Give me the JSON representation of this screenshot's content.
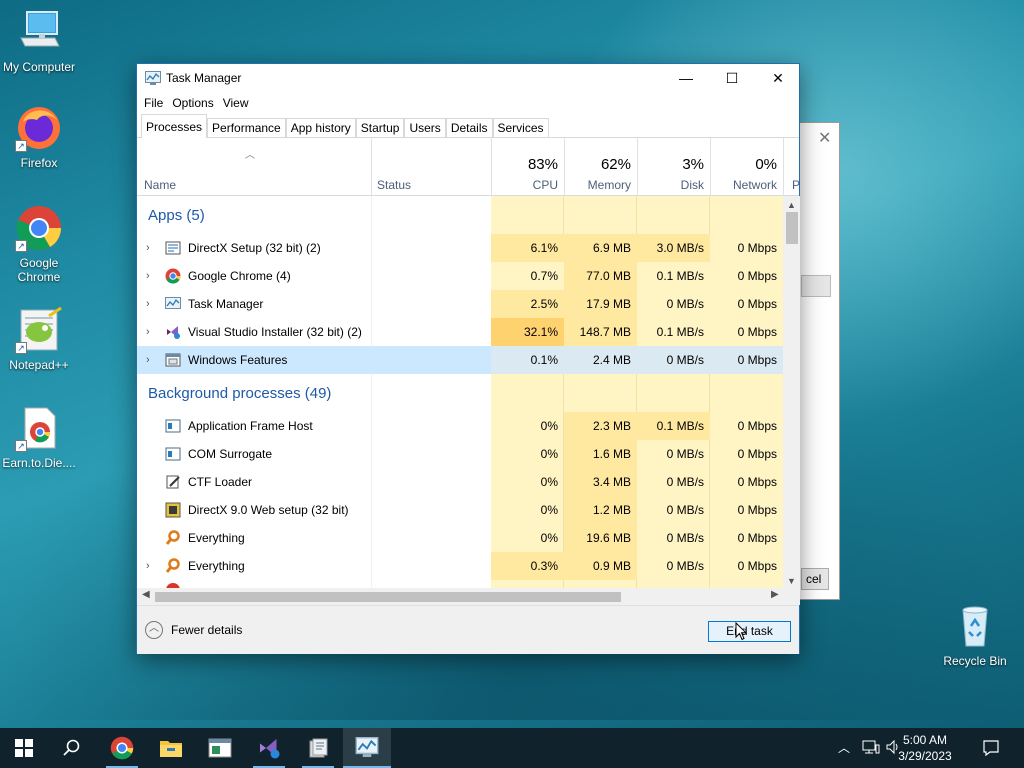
{
  "desktop": {
    "icons": [
      {
        "label": "My Computer"
      },
      {
        "label": "Firefox"
      },
      {
        "label": "Google Chrome"
      },
      {
        "label": "Notepad++"
      },
      {
        "label": "Earn.to.Die...."
      },
      {
        "label": "Recycle Bin"
      }
    ]
  },
  "background_dialog": {
    "button_label": "cel"
  },
  "task_manager": {
    "title": "Task Manager",
    "menu": [
      "File",
      "Options",
      "View"
    ],
    "tabs": [
      "Processes",
      "Performance",
      "App history",
      "Startup",
      "Users",
      "Details",
      "Services"
    ],
    "active_tab": "Processes",
    "columns": {
      "name": "Name",
      "status": "Status",
      "cpu": {
        "pct": "83%",
        "label": "CPU"
      },
      "memory": {
        "pct": "62%",
        "label": "Memory"
      },
      "disk": {
        "pct": "3%",
        "label": "Disk"
      },
      "network": {
        "pct": "0%",
        "label": "Network"
      },
      "power_partial": "P"
    },
    "groups": {
      "apps": "Apps (5)",
      "background": "Background processes (49)"
    },
    "apps": [
      {
        "name": "DirectX Setup (32 bit) (2)",
        "cpu": "6.1%",
        "memory": "6.9 MB",
        "disk": "3.0 MB/s",
        "network": "0 Mbps"
      },
      {
        "name": "Google Chrome (4)",
        "cpu": "0.7%",
        "memory": "77.0 MB",
        "disk": "0.1 MB/s",
        "network": "0 Mbps"
      },
      {
        "name": "Task Manager",
        "cpu": "2.5%",
        "memory": "17.9 MB",
        "disk": "0 MB/s",
        "network": "0 Mbps"
      },
      {
        "name": "Visual Studio Installer (32 bit) (2)",
        "cpu": "32.1%",
        "memory": "148.7 MB",
        "disk": "0.1 MB/s",
        "network": "0 Mbps"
      },
      {
        "name": "Windows Features",
        "cpu": "0.1%",
        "memory": "2.4 MB",
        "disk": "0 MB/s",
        "network": "0 Mbps"
      }
    ],
    "background": [
      {
        "name": "Application Frame Host",
        "cpu": "0%",
        "memory": "2.3 MB",
        "disk": "0.1 MB/s",
        "network": "0 Mbps"
      },
      {
        "name": "COM Surrogate",
        "cpu": "0%",
        "memory": "1.6 MB",
        "disk": "0 MB/s",
        "network": "0 Mbps"
      },
      {
        "name": "CTF Loader",
        "cpu": "0%",
        "memory": "3.4 MB",
        "disk": "0 MB/s",
        "network": "0 Mbps"
      },
      {
        "name": "DirectX 9.0 Web setup (32 bit)",
        "cpu": "0%",
        "memory": "1.2 MB",
        "disk": "0 MB/s",
        "network": "0 Mbps"
      },
      {
        "name": "Everything",
        "cpu": "0%",
        "memory": "19.6 MB",
        "disk": "0 MB/s",
        "network": "0 Mbps"
      },
      {
        "name": "Everything",
        "cpu": "0.3%",
        "memory": "0.9 MB",
        "disk": "0 MB/s",
        "network": "0 Mbps"
      }
    ],
    "footer": {
      "fewer_details": "Fewer details",
      "end_task": "End task"
    }
  },
  "taskbar": {
    "time": "5:00 AM",
    "date": "3/29/2023"
  },
  "colors": {
    "accent": "#0078d7",
    "heat_low": "#fff4c4",
    "heat_mid": "#ffe8a0",
    "heat_high": "#ffd270",
    "selected_row": "#cce8ff",
    "group_header": "#1e5aa8"
  }
}
